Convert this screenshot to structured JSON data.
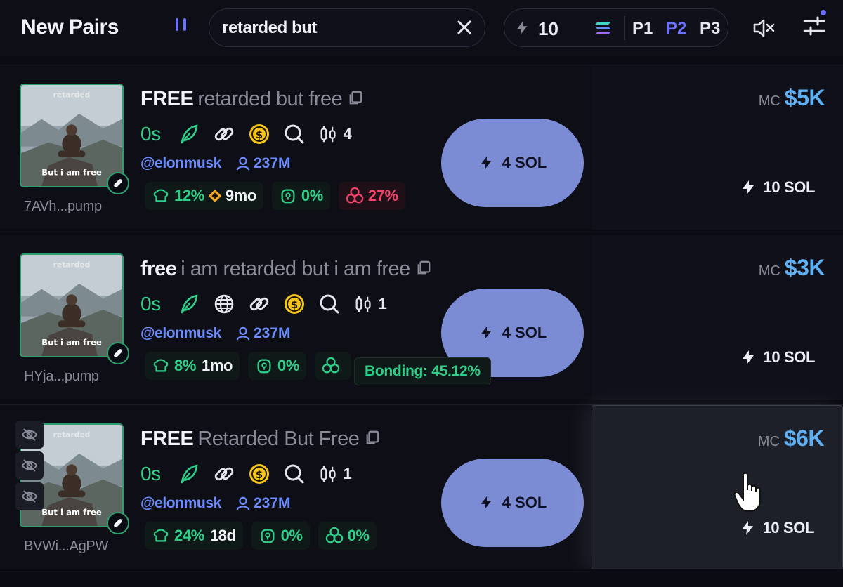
{
  "header": {
    "title": "New Pairs",
    "search_value": "retarded but",
    "quick_buy_amount": "10",
    "presets": [
      "P1",
      "P2",
      "P3"
    ],
    "active_preset": "P2"
  },
  "colors": {
    "accent": "#6c72ff",
    "green": "#2fcf8a",
    "red": "#f0426a",
    "mc_blue": "#5fb0f2",
    "buy_button": "#7b8cd4"
  },
  "rows": [
    {
      "ticker": "FREE",
      "name": "retarded but free",
      "address": "7AVh...pump",
      "age": "0s",
      "holders": "4",
      "handle": "@elonmusk",
      "followers": "237M",
      "stats": {
        "top10": "12%",
        "dev_age": "9mo",
        "dev_holding": "0%",
        "snipers": "27%"
      },
      "buy_label": "4 SOL",
      "mc_label": "MC",
      "mc_value": "$5K",
      "right_buy_label": "10 SOL",
      "icons": [
        "leaf-icon",
        "link-icon",
        "coin-icon",
        "search-icon",
        "holders-icon"
      ]
    },
    {
      "ticker": "free",
      "name": "i am retarded but i am free",
      "address": "HYja...pump",
      "age": "0s",
      "holders": "1",
      "handle": "@elonmusk",
      "followers": "237M",
      "stats": {
        "top10": "8%",
        "dev_age": "1mo",
        "dev_holding": "0%"
      },
      "tooltip": "Bonding: 45.12%",
      "buy_label": "4 SOL",
      "mc_label": "MC",
      "mc_value": "$3K",
      "right_buy_label": "10 SOL",
      "icons": [
        "leaf-icon",
        "globe-icon",
        "link-icon",
        "coin-icon",
        "search-icon",
        "holders-icon"
      ]
    },
    {
      "ticker": "FREE",
      "name": "Retarded But Free",
      "address": "BVWi...AgPW",
      "age": "0s",
      "holders": "1",
      "handle": "@elonmusk",
      "followers": "237M",
      "stats": {
        "top10": "24%",
        "dev_age": "18d",
        "dev_holding": "0%",
        "snipers": "0%"
      },
      "buy_label": "4 SOL",
      "mc_label": "MC",
      "mc_value": "$6K",
      "right_buy_label": "10 SOL",
      "icons": [
        "leaf-icon",
        "link-icon",
        "coin-icon",
        "search-icon",
        "holders-icon"
      ]
    }
  ]
}
